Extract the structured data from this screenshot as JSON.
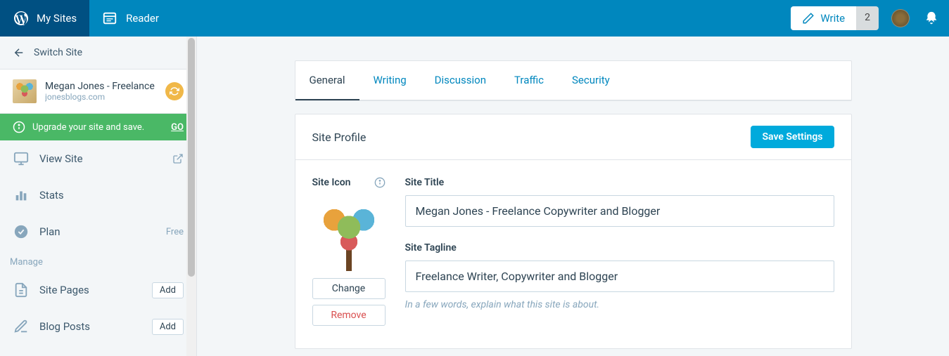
{
  "topbar": {
    "my_sites": "My Sites",
    "reader": "Reader",
    "write": "Write",
    "write_count": "2"
  },
  "sidebar": {
    "switch_site": "Switch Site",
    "site": {
      "name": "Megan Jones - Freelance",
      "domain": "jonesblogs.com"
    },
    "upgrade": {
      "text": "Upgrade your site and save.",
      "go": "GO"
    },
    "view_site": "View Site",
    "stats": "Stats",
    "plan": {
      "label": "Plan",
      "value": "Free"
    },
    "manage_label": "Manage",
    "site_pages": {
      "label": "Site Pages",
      "add": "Add"
    },
    "blog_posts": {
      "label": "Blog Posts",
      "add": "Add"
    }
  },
  "tabs": {
    "general": "General",
    "writing": "Writing",
    "discussion": "Discussion",
    "traffic": "Traffic",
    "security": "Security"
  },
  "panel": {
    "title": "Site Profile",
    "save": "Save Settings",
    "site_icon_label": "Site Icon",
    "change": "Change",
    "remove": "Remove",
    "site_title_label": "Site Title",
    "site_title_value": "Megan Jones - Freelance Copywriter and Blogger",
    "site_tagline_label": "Site Tagline",
    "site_tagline_value": "Freelance Writer, Copywriter and Blogger",
    "tagline_help": "In a few words, explain what this site is about."
  }
}
